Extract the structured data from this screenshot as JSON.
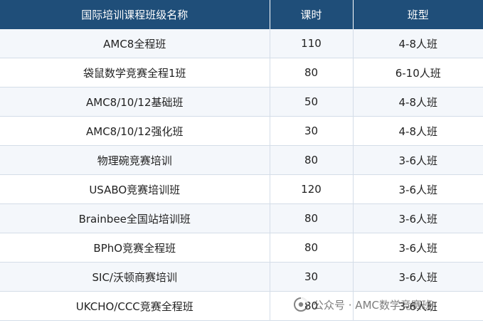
{
  "table": {
    "headers": [
      "国际培训课程班级名称",
      "课时",
      "班型"
    ],
    "rows": [
      [
        "AMC8全程班",
        "110",
        "4-8人班"
      ],
      [
        "袋鼠数学竞赛全程1班",
        "80",
        "6-10人班"
      ],
      [
        "AMC8/10/12基础班",
        "50",
        "4-8人班"
      ],
      [
        "AMC8/10/12强化班",
        "30",
        "4-8人班"
      ],
      [
        "物理碗竞赛培训",
        "80",
        "3-6人班"
      ],
      [
        "USABO竞赛培训班",
        "120",
        "3-6人班"
      ],
      [
        "Brainbee全国站培训班",
        "80",
        "3-6人班"
      ],
      [
        "BPhO竞赛全程班",
        "80",
        "3-6人班"
      ],
      [
        "SIC/沃顿商赛培训",
        "30",
        "3-6人班"
      ],
      [
        "UKCHO/CCC竞赛全程班",
        "80",
        "3-6人班"
      ]
    ]
  },
  "watermark": {
    "text": "公众号 · AMC数学竞赛班",
    "icon": "wechat-official-account-icon"
  },
  "colors": {
    "header_bg": "#1f4e79",
    "header_text": "#ffffff",
    "row_alt_bg": "#f4f7fb",
    "grid_line": "#d4dde8"
  }
}
